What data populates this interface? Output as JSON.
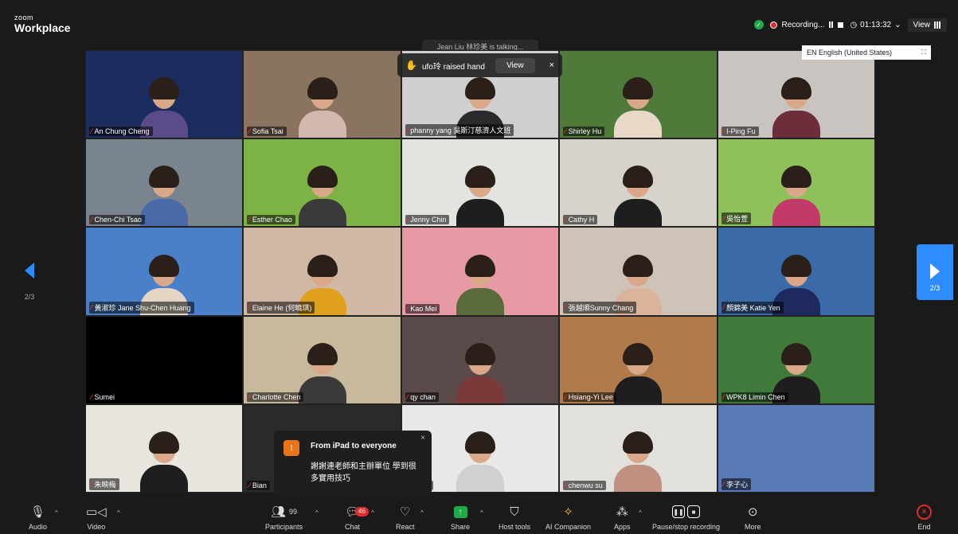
{
  "app": {
    "logo_small": "zoom",
    "logo_main": "Workplace"
  },
  "recording": {
    "label": "Recording...",
    "timer": "01:13:32",
    "view_label": "View"
  },
  "talking": {
    "text": "Jean Liu 林珍美 is talking..."
  },
  "raise_hand": {
    "text": "ufo玲 raised hand",
    "view_label": "View",
    "close": "×"
  },
  "captions": {
    "language": "EN English (United States)"
  },
  "pager": {
    "left": "2/3",
    "right": "2/3"
  },
  "participants": [
    {
      "name": "An Chung Cheng",
      "bg": "#1b2c5e",
      "shirt": "#5b4b8a"
    },
    {
      "name": "Sofia Tsai",
      "bg": "#8a7460",
      "shirt": "#d4b8b0"
    },
    {
      "name": "phanny yang 吳斯汀慈濟人文班",
      "bg": "#cfcfcf",
      "shirt": "#2a2a2a"
    },
    {
      "name": "Shirley Hu",
      "bg": "#4f7a3a",
      "shirt": "#e8d8c8"
    },
    {
      "name": "I-Ping Fu",
      "bg": "#c9c4c0",
      "shirt": "#6b2e3a"
    },
    {
      "name": "Chen-Chi Tsao",
      "bg": "#7a848e",
      "shirt": "#4a6aa8"
    },
    {
      "name": "Esther Chao",
      "bg": "#7db344",
      "shirt": "#3a3a3a"
    },
    {
      "name": "Jenny Chin",
      "bg": "#e3e3df",
      "shirt": "#1e1e1e"
    },
    {
      "name": "Cathy H",
      "bg": "#d7d3cc",
      "shirt": "#1e1e1e"
    },
    {
      "name": "吳怡萱",
      "bg": "#8fc15a",
      "shirt": "#c23a6a"
    },
    {
      "name": "黃淑珍 Jane Shu-Chen Huang",
      "bg": "#4a7fc9",
      "shirt": "#e4d4c4"
    },
    {
      "name": "Elaine He (何曉琪)",
      "bg": "#d0b8a4",
      "shirt": "#e0a020"
    },
    {
      "name": "Kao Mei",
      "bg": "#e69aa6",
      "shirt": "#5a6a3a"
    },
    {
      "name": "張越順Sunny Chang",
      "bg": "#cfc3b8",
      "shirt": "#d9b49a"
    },
    {
      "name": "顏錦美 Katie Yen",
      "bg": "#3a6aa8",
      "shirt": "#1e2a5e"
    },
    {
      "name": "Sumei",
      "bg": "#000000",
      "shirt": "#000000",
      "empty": true
    },
    {
      "name": "Charlotte Chen",
      "bg": "#c8b89c",
      "shirt": "#3a3a3a"
    },
    {
      "name": "qy chan",
      "bg": "#5a4a4a",
      "shirt": "#7a3a3a"
    },
    {
      "name": "Hsiang-Yi Lee",
      "bg": "#b07a4a",
      "shirt": "#1e1e1e"
    },
    {
      "name": "WPK8 Limin Chen",
      "bg": "#3f7a3a",
      "shirt": "#1e1e1e"
    },
    {
      "name": "朱映梅",
      "bg": "#e8e4de",
      "shirt": "#1e1e1e"
    },
    {
      "name": "Bian",
      "bg": "#2a2a2a",
      "shirt": "#2a2a2a"
    },
    {
      "name": "chang",
      "bg": "#e8e8e8",
      "shirt": "#d0d0d0"
    },
    {
      "name": "chenwu su",
      "bg": "#e2e0dc",
      "shirt": "#c09080"
    },
    {
      "name": "李子心",
      "bg": "#5a7ab8",
      "shirt": "#3a5ab0",
      "empty": true
    }
  ],
  "chat_popup": {
    "avatar_letter": "I",
    "from": "From iPad to everyone",
    "message": "謝謝連老師和主辦單位 學到很多實用技巧",
    "close": "×"
  },
  "toolbar": {
    "audio": "Audio",
    "video": "Video",
    "participants": "Participants",
    "participants_count": "99",
    "chat": "Chat",
    "chat_badge": "46",
    "react": "React",
    "share": "Share",
    "host_tools": "Host tools",
    "ai_companion": "AI Companion",
    "apps": "Apps",
    "pause_stop": "Pause/stop recording",
    "more": "More",
    "end": "End"
  }
}
